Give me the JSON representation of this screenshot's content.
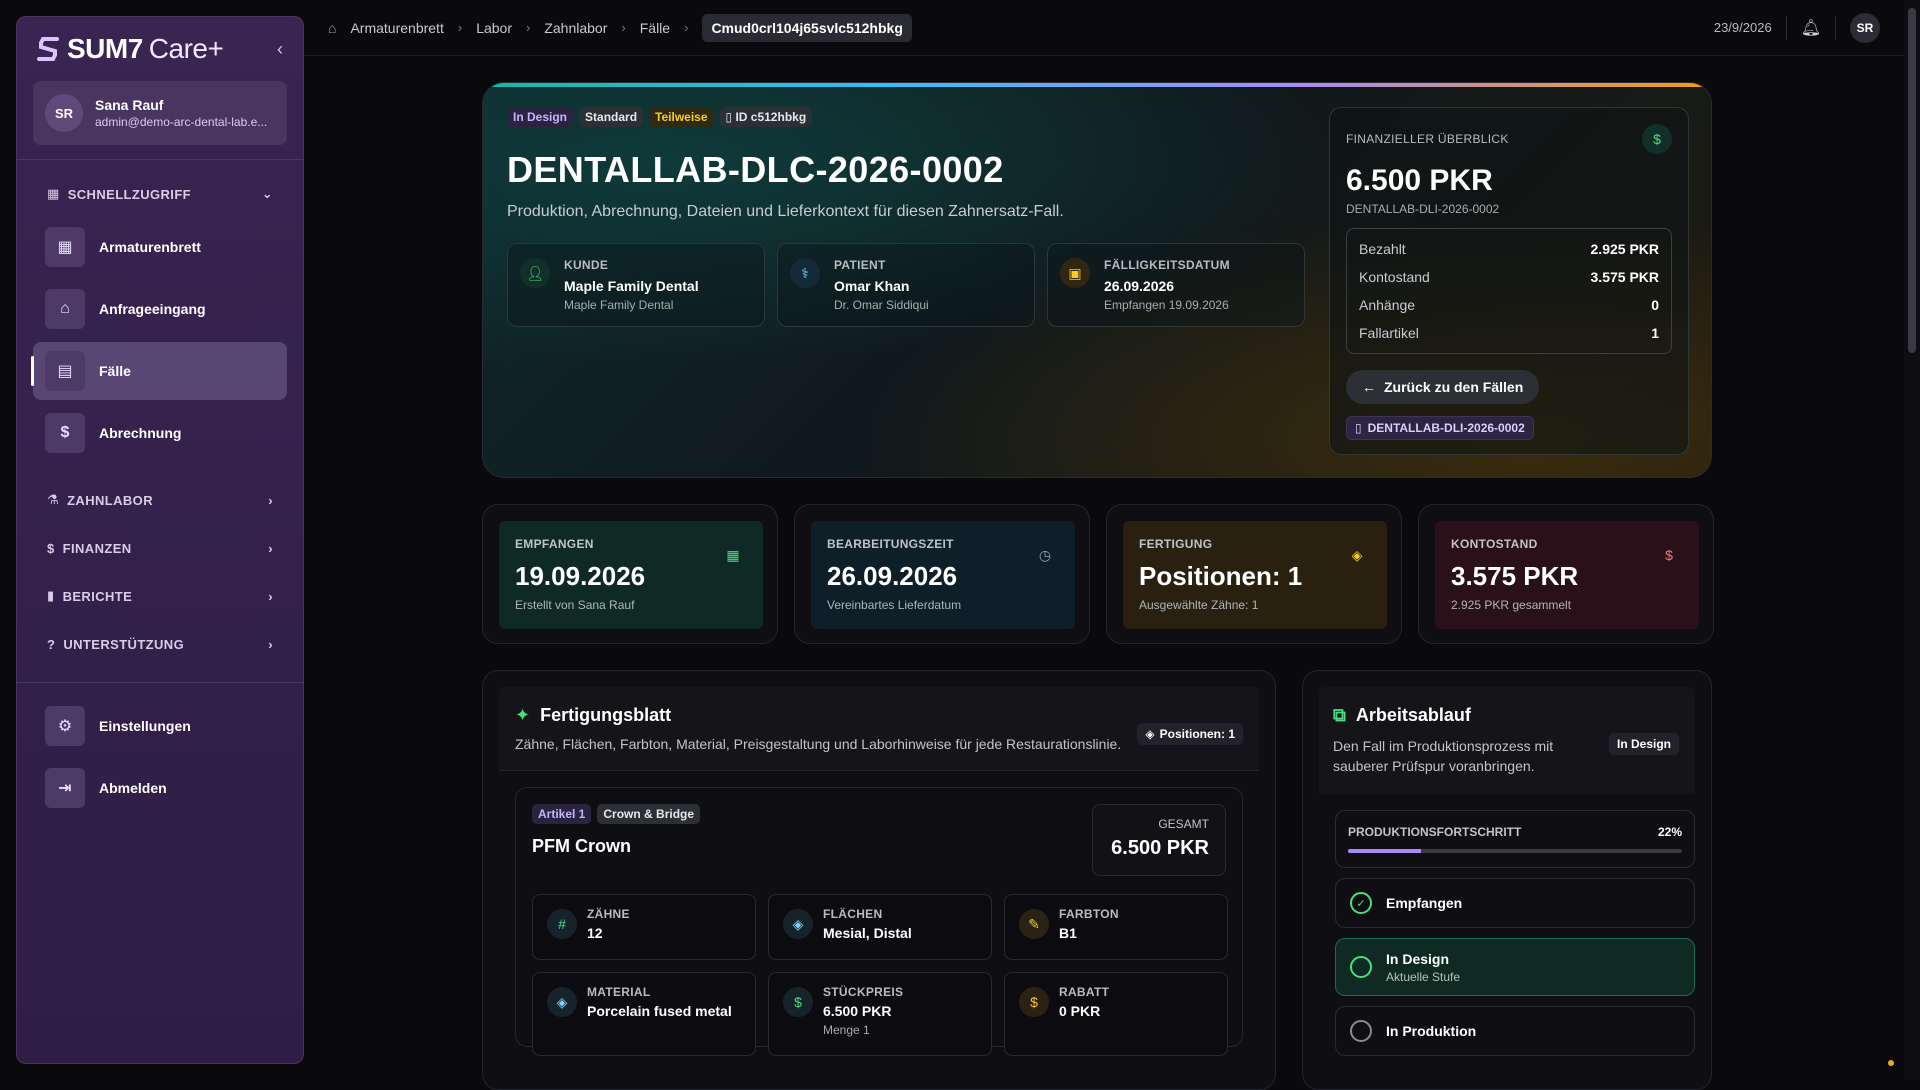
{
  "sidebar": {
    "logo_main": "SUM7",
    "logo_suffix": "Care+",
    "user": {
      "initials": "SR",
      "name": "Sana Rauf",
      "email": "admin@demo-arc-dental-lab.e..."
    },
    "quick_access_label": "SCHNELLZUGRIFF",
    "items": [
      {
        "label": "Armaturenbrett",
        "icon": "dashboard-icon"
      },
      {
        "label": "Anfrageeingang",
        "icon": "inbox-icon"
      },
      {
        "label": "Fälle",
        "icon": "clipboard-icon"
      },
      {
        "label": "Abrechnung",
        "icon": "invoice-icon"
      }
    ],
    "sections": [
      {
        "label": "ZAHNLABOR",
        "icon": "flask-icon"
      },
      {
        "label": "FINANZEN",
        "icon": "dollar-icon"
      },
      {
        "label": "BERICHTE",
        "icon": "bar-chart-icon"
      },
      {
        "label": "UNTERSTÜTZUNG",
        "icon": "help-icon"
      }
    ],
    "footer_items": [
      {
        "label": "Einstellungen",
        "icon": "gear-icon"
      },
      {
        "label": "Abmelden",
        "icon": "logout-icon"
      }
    ]
  },
  "breadcrumb": [
    "Armaturenbrett",
    "Labor",
    "Zahnlabor",
    "Fälle",
    "Cmud0crl104j65svlc512hbkg"
  ],
  "topbar": {
    "date": "23/9/2026",
    "avatar": "SR"
  },
  "hero": {
    "pills": [
      {
        "label": "In Design",
        "color": "#c4b5fd"
      },
      {
        "label": "Standard",
        "color": "#e5e7eb"
      },
      {
        "label": "Teilweise",
        "color": "#facc15"
      },
      {
        "label": "ID c512hbkg",
        "color": "#e5e7eb"
      }
    ],
    "title": "DENTALLAB-DLC-2026-0002",
    "subtitle": "Produktion, Abrechnung, Dateien und Lieferkontext für diesen Zahnersatz-Fall.",
    "cards": [
      {
        "label": "KUNDE",
        "value": "Maple Family Dental",
        "sub": "Maple Family Dental",
        "icon": "user-icon"
      },
      {
        "label": "PATIENT",
        "value": "Omar Khan",
        "sub": "Dr. Omar Siddiqui",
        "icon": "stethoscope-icon"
      },
      {
        "label": "FÄLLIGKEITSDATUM",
        "value": "26.09.2026",
        "sub": "Empfangen 19.09.2026",
        "icon": "calendar-clock-icon"
      }
    ],
    "finance": {
      "label": "FINANZIELLER ÜBERBLICK",
      "amount": "6.500 PKR",
      "ref": "DENTALLAB-DLI-2026-0002",
      "rows": [
        {
          "k": "Bezahlt",
          "v": "2.925 PKR"
        },
        {
          "k": "Kontostand",
          "v": "3.575 PKR"
        },
        {
          "k": "Anhänge",
          "v": "0"
        },
        {
          "k": "Fallartikel",
          "v": "1"
        }
      ],
      "back_button": "Zurück zu den Fällen",
      "invoice_tag": "DENTALLAB-DLI-2026-0002"
    }
  },
  "stats": [
    {
      "label": "EMPFANGEN",
      "value": "19.09.2026",
      "sub": "Erstellt von Sana Rauf",
      "bg": "#0f2a24",
      "iconColor": "#4ade80",
      "icon": "calendar-icon"
    },
    {
      "label": "BEARBEITUNGSZEIT",
      "value": "26.09.2026",
      "sub": "Vereinbartes Lieferdatum",
      "bg": "#0e1f2a",
      "iconColor": "#9ca3af",
      "icon": "timer-icon"
    },
    {
      "label": "FERTIGUNG",
      "value": "Positionen: 1",
      "sub": "Ausgewählte Zähne: 1",
      "bg": "#2a2010",
      "iconColor": "#facc15",
      "icon": "layers-icon"
    },
    {
      "label": "KONTOSTAND",
      "value": "3.575 PKR",
      "sub": "2.925 PKR gesammelt",
      "bg": "#2a1018",
      "iconColor": "#f87171",
      "icon": "dollar-circle-icon"
    }
  ],
  "production": {
    "title": "Fertigungsblatt",
    "subtitle": "Zähne, Flächen, Farbton, Material, Preisgestaltung und Laborhinweise für jede Restaurationslinie.",
    "badge": "Positionen: 1",
    "item": {
      "pills": [
        "Artikel 1",
        "Crown & Bridge"
      ],
      "name": "PFM Crown",
      "total_label": "GESAMT",
      "total": "6.500 PKR",
      "cells": [
        {
          "label": "ZÄHNE",
          "value": "12",
          "sub": "",
          "icon": "hash-icon"
        },
        {
          "label": "FLÄCHEN",
          "value": "Mesial, Distal",
          "sub": "",
          "icon": "layers-icon"
        },
        {
          "label": "FARBTON",
          "value": "B1",
          "sub": "",
          "icon": "brush-icon"
        },
        {
          "label": "MATERIAL",
          "value": "Porcelain fused metal",
          "sub": "",
          "icon": "layers-icon"
        },
        {
          "label": "STÜCKPREIS",
          "value": "6.500 PKR",
          "sub": "Menge 1",
          "icon": "dollar-icon"
        },
        {
          "label": "RABATT",
          "value": "0 PKR",
          "sub": "",
          "icon": "dollar-icon"
        }
      ]
    }
  },
  "workflow": {
    "title": "Arbeitsablauf",
    "subtitle": "Den Fall im Produktionsprozess mit sauberer Prüfspur voranbringen.",
    "badge": "In Design",
    "progress_label": "PRODUKTIONSFORTSCHRITT",
    "progress_text": "22%",
    "progress": 0.22,
    "steps": [
      {
        "label": "Empfangen",
        "sub": "",
        "state": "done"
      },
      {
        "label": "In Design",
        "sub": "Aktuelle Stufe",
        "state": "current"
      },
      {
        "label": "In Produktion",
        "sub": "",
        "state": "pending"
      }
    ]
  }
}
